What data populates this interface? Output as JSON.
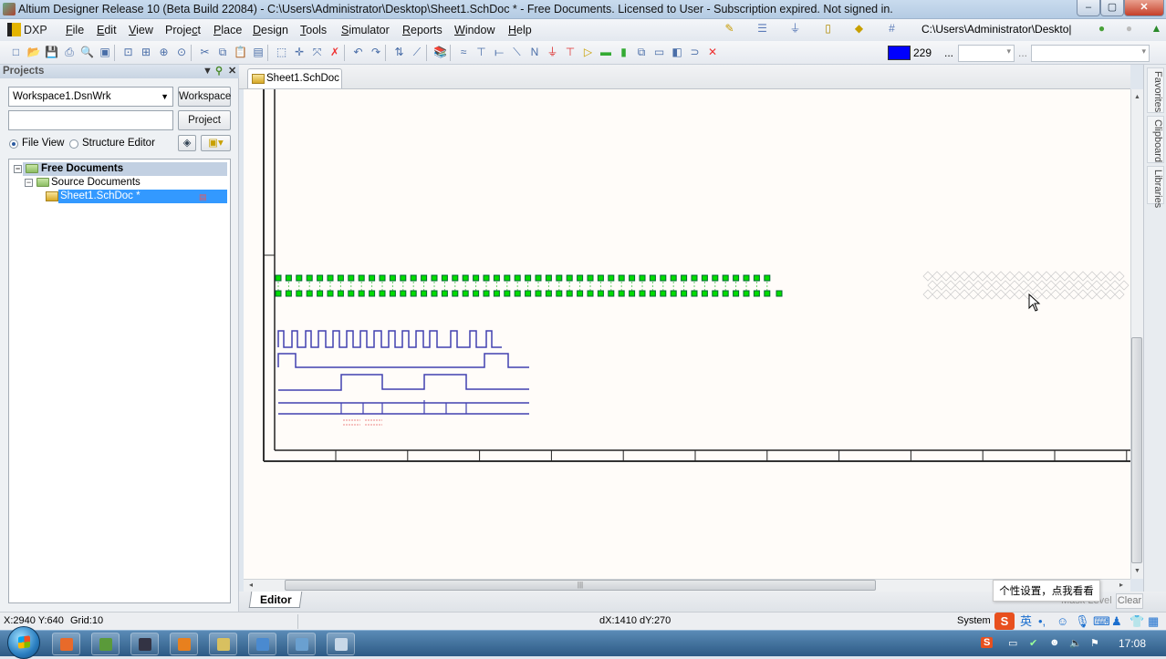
{
  "window": {
    "title": "Altium Designer Release 10 (Beta Build 22084) - C:\\Users\\Administrator\\Desktop\\Sheet1.SchDoc * - Free Documents. Licensed to User - Subscription expired. Not signed in.",
    "controls": {
      "minimize": "–",
      "maximize": "▢",
      "close": "✕"
    }
  },
  "menubar": {
    "dxp": "DXP",
    "items": [
      {
        "label": "File",
        "accel": "F"
      },
      {
        "label": "Edit",
        "accel": "E"
      },
      {
        "label": "View",
        "accel": "V"
      },
      {
        "label": "Project",
        "accel": "c"
      },
      {
        "label": "Place",
        "accel": "P"
      },
      {
        "label": "Design",
        "accel": "D"
      },
      {
        "label": "Tools",
        "accel": "T"
      },
      {
        "label": "Simulator",
        "accel": "S"
      },
      {
        "label": "Reports",
        "accel": "R"
      },
      {
        "label": "Window",
        "accel": "W"
      },
      {
        "label": "Help",
        "accel": "H"
      }
    ]
  },
  "toolbar": {
    "path_combo": "C:\\Users\\Administrator\\Deskto|",
    "color_value": "229",
    "color_hex": "#0000ff",
    "ellipsis": "...",
    "icons": [
      "new-document",
      "open",
      "save",
      "print",
      "print-preview",
      "component-view",
      "zoom-fit",
      "zoom-area",
      "zoom-in",
      "zoom-selected",
      "cut",
      "copy",
      "paste",
      "rubber-stamp",
      "select-area",
      "move",
      "deselect",
      "clear-filter",
      "undo",
      "redo",
      "hierarchy-up-down",
      "cross-probe",
      "browse-library",
      "bus",
      "bus-entry",
      "wire",
      "signal-harness",
      "net-label",
      "gnd-power",
      "vcc-power",
      "part",
      "sheet-symbol",
      "sheet-entry",
      "device-sheet",
      "harness-connector",
      "harness-entry",
      "port",
      "no-erc"
    ],
    "right_icons": [
      "drawing-tools",
      "align",
      "power-ports",
      "digital-parts",
      "simulation-sources",
      "grid"
    ],
    "nav_icons": [
      "back",
      "forward",
      "home"
    ],
    "vcc_label": "Vcc",
    "net_label": "Net"
  },
  "projects_panel": {
    "title": "Projects",
    "workspace_value": "Workspace1.DsnWrk",
    "project_value": "",
    "workspace_button": "Workspace",
    "project_button": "Project",
    "view_options": [
      {
        "label": "File View",
        "selected": true
      },
      {
        "label": "Structure Editor",
        "selected": false
      }
    ],
    "tree": [
      {
        "label": "Free Documents",
        "level": 0,
        "expanded": true,
        "bold": true
      },
      {
        "label": "Source Documents",
        "level": 1,
        "expanded": true
      },
      {
        "label": "Sheet1.SchDoc *",
        "level": 2,
        "selected": true
      }
    ]
  },
  "document_tabs": [
    {
      "label": "Sheet1.SchDoc *",
      "active": true
    }
  ],
  "side_tabs": [
    "Favorites",
    "Clipboard",
    "Libraries"
  ],
  "schematic": {
    "pin_rows": 2,
    "pins_per_row": 48,
    "pin_color": "#00dd00",
    "waveform_color": "#4040b0"
  },
  "bottom_tabs": [
    {
      "label": "Editor",
      "active": true
    }
  ],
  "bottom_right": {
    "mask_level": "Mask Level",
    "clear": "Clear"
  },
  "tooltip": "个性设置，点我看看",
  "statusbar": {
    "coords": "X:2940 Y:640",
    "grid": "Grid:10",
    "delta": "dX:1410 dY:270",
    "system": "System"
  },
  "ime": {
    "logo": "S",
    "lang": "英",
    "punct": "•,",
    "icons": [
      "emoji",
      "voice",
      "keyboard",
      "user",
      "skin",
      "menu"
    ]
  },
  "taskbar": {
    "apps": [
      "uc-browser",
      "terminal",
      "virtualbox",
      "app-orange",
      "file-explorer",
      "network-tool",
      "paint",
      "notepad"
    ],
    "tray": [
      "sogou",
      "display",
      "network",
      "user-icon",
      "volume",
      "action-center"
    ],
    "clock": "17:08"
  }
}
